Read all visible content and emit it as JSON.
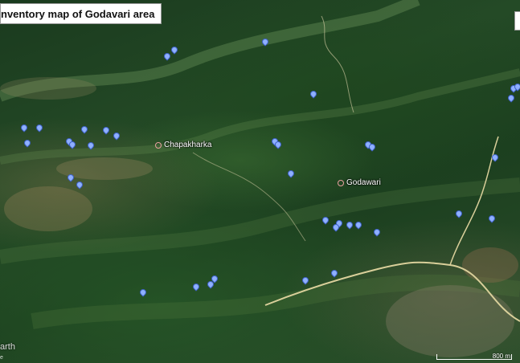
{
  "title": "nventory map of Godavari area",
  "places": [
    {
      "name": "Chapakharka"
    },
    {
      "name": "Godawari"
    }
  ],
  "watermark": "arth",
  "watermark_small": "e",
  "scale_label": "800 m",
  "colors": {
    "pin": "#8fb0ff",
    "pin_border": "#3f62c7",
    "road": "#d9cf9a",
    "place_marker": "#e9a0a0"
  },
  "marker_icon": "map-pin"
}
